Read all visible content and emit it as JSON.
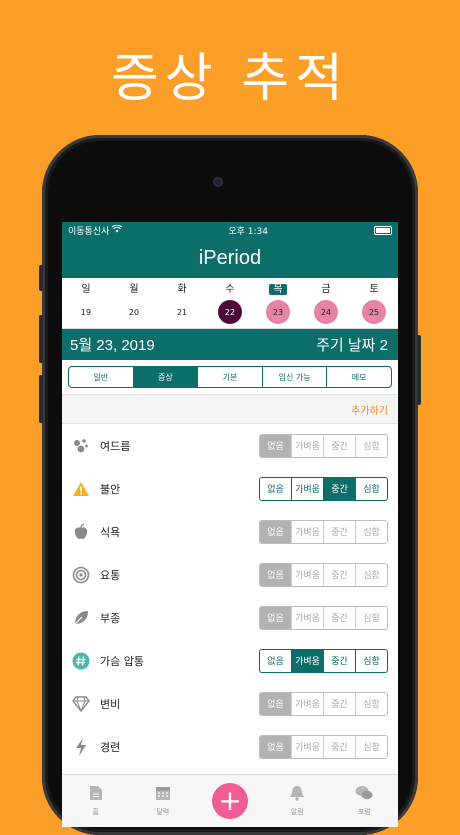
{
  "promo": {
    "title": "증상 추적"
  },
  "status": {
    "carrier": "이동통신사",
    "time": "오후 1:34"
  },
  "app": {
    "title": "iPeriod"
  },
  "week": [
    {
      "name": "일",
      "num": "19",
      "state": "none",
      "today": false
    },
    {
      "name": "월",
      "num": "20",
      "state": "none",
      "today": false
    },
    {
      "name": "화",
      "num": "21",
      "state": "none",
      "today": false
    },
    {
      "name": "수",
      "num": "22",
      "state": "selected",
      "today": false
    },
    {
      "name": "목",
      "num": "23",
      "state": "period",
      "today": true
    },
    {
      "name": "금",
      "num": "24",
      "state": "period",
      "today": false
    },
    {
      "name": "토",
      "num": "25",
      "state": "period",
      "today": false
    }
  ],
  "date_bar": {
    "date": "5월 23, 2019",
    "cycle": "주기 날짜 2"
  },
  "tabs": [
    {
      "label": "일반",
      "active": false
    },
    {
      "label": "증상",
      "active": true
    },
    {
      "label": "기분",
      "active": false
    },
    {
      "label": "임신 가능",
      "active": false
    },
    {
      "label": "메모",
      "active": false
    }
  ],
  "add_label": "추가하기",
  "levels": [
    "없음",
    "가벼움",
    "중간",
    "심함"
  ],
  "symptoms": [
    {
      "label": "여드름",
      "icon": "acne-icon",
      "mode": "grey",
      "selected": 0
    },
    {
      "label": "불안",
      "icon": "warning-icon",
      "mode": "teal",
      "selected": 2
    },
    {
      "label": "식욕",
      "icon": "apple-icon",
      "mode": "grey",
      "selected": 0
    },
    {
      "label": "요통",
      "icon": "target-icon",
      "mode": "grey",
      "selected": 0
    },
    {
      "label": "부종",
      "icon": "leaf-icon",
      "mode": "grey",
      "selected": 0
    },
    {
      "label": "가슴 압통",
      "icon": "hashtag-icon",
      "mode": "teal",
      "selected": 1
    },
    {
      "label": "변비",
      "icon": "diamond-icon",
      "mode": "grey",
      "selected": 0
    },
    {
      "label": "경련",
      "icon": "lightning-icon",
      "mode": "grey",
      "selected": 0
    }
  ],
  "tabbar": [
    {
      "label": "홈",
      "icon": "home-doc-icon"
    },
    {
      "label": "달력",
      "icon": "calendar-icon"
    },
    {
      "label": "",
      "icon": "plus-icon"
    },
    {
      "label": "알림",
      "icon": "bell-icon"
    },
    {
      "label": "포럼",
      "icon": "chat-bubbles-icon"
    }
  ],
  "colors": {
    "background": "#FB9F28",
    "teal": "#0C6E6A",
    "selected_day": "#4A0B3C",
    "period_day": "#E783A8",
    "accent": "#F05C93",
    "add": "#F08A1C"
  }
}
